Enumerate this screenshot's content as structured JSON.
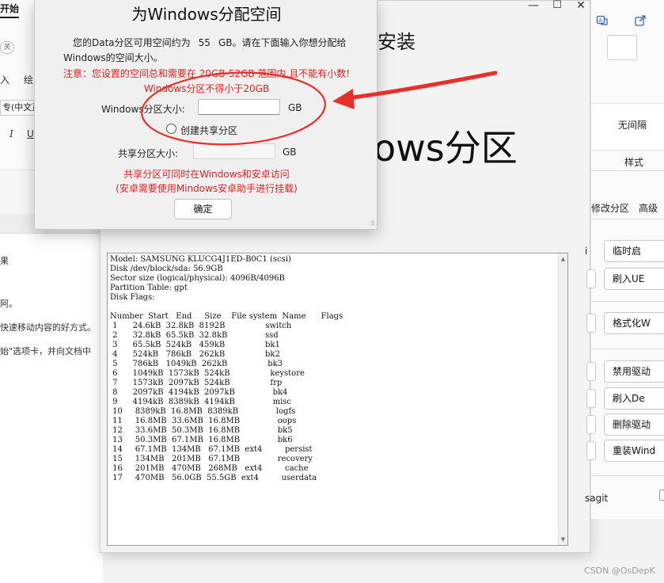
{
  "word": {
    "tab_start": "开始",
    "pill": "关",
    "row_a": "入",
    "row_b": "绘",
    "font_name": "专(中文正",
    "italic": "I",
    "underline": "U",
    "doc_lines": [
      "果",
      "阿。",
      "快速移动内容的好方式。",
      "始\"选项卡，并向文档中"
    ]
  },
  "installer": {
    "heading": "安装",
    "big_title": "ows分区",
    "minimize": "—",
    "maximize": "☐",
    "close": "✕",
    "console_text": "Model: SAMSUNG KLUCG4J1ED-B0C1 (scsi)\nDisk /dev/block/sda: 56.9GB\nSector size (logical/physical): 4096B/4096B\nPartition Table: gpt\nDisk Flags:\n\nNumber  Start   End     Size    File system  Name      Flags\n 1      24.6kB  32.8kB  8192B                switch\n 2      32.8kB  65.5kB  32.8kB               ssd\n 3      65.5kB  524kB   459kB                bk1\n 4      524kB   786kB   262kB                bk2\n 5      786kB   1049kB  262kB                bk3\n 6      1049kB  1573kB  524kB                keystore\n 7      1573kB  2097kB  524kB                frp\n 8      2097kB  4194kB  2097kB               bk4\n 9      4194kB  8389kB  4194kB               misc\n 10     8389kB  16.8MB  8389kB               logfs\n 11     16.8MB  33.6MB  16.8MB               oops\n 12     33.6MB  50.3MB  16.8MB               bk5\n 13     50.3MB  67.1MB  16.8MB               bk6\n 14     67.1MB  134MB   67.1MB  ext4         persist\n 15     134MB   201MB   67.1MB               recovery\n 16     201MB   470MB   268MB   ext4         cache\n 17     470MB   56.0GB  55.5GB  ext4         userdata"
  },
  "rpanel": {
    "no_spacing": "无间隔",
    "styles": "样式",
    "modify_partition": "修改分区",
    "advanced": "高级",
    "btn_temp": "临时启",
    "btn_flash_uefi": "刷入UE",
    "btn_format": "格式化W",
    "btn_disable_driver": "禁用驱动",
    "btn_flash_de": "刷入De",
    "btn_delete_driver": "删除驱动",
    "btn_reinstall": "重装Wind",
    "partial_left": "i",
    "sagit": "sagit"
  },
  "dialog": {
    "title": "为Windows分配空间",
    "info_part1": "您的Data分区可用空间约为",
    "info_value": "55",
    "info_part2": "GB。请在下面输入你想分配给",
    "info_line2": "Windows的空间大小。",
    "warn1": "注意：您设置的空间总和需要在 20GB-52GB 范围内,且不能有小数!",
    "warn2": "Windows分区不得小于20GB",
    "windows_size_label": "Windows分区大小:",
    "windows_size_value": "",
    "unit_gb": "GB",
    "create_shared_label": "创建共享分区",
    "shared_size_label": "共享分区大小:",
    "shared_size_value": "",
    "shared_unit": "GB",
    "shared_note1": "共享分区可同时在Windows和安卓访问",
    "shared_note2": "(安卓需要使用Mindows安卓助手进行挂载)",
    "ok_button": "确定"
  },
  "annotation": {
    "color": "#e8302a"
  },
  "watermark": "CSDN @OsDepK"
}
